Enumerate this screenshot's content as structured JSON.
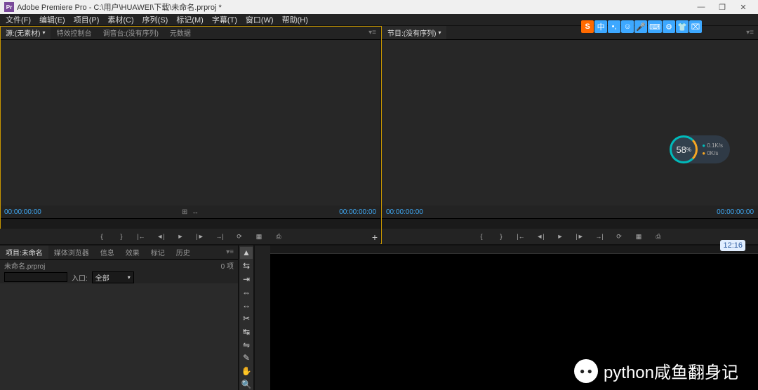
{
  "window": {
    "app_icon_text": "Pr",
    "title": "Adobe Premiere Pro - C:\\用户\\HUAWEI\\下载\\未命名.prproj *",
    "min": "—",
    "max": "❐",
    "close": "✕"
  },
  "menu": {
    "file": "文件(F)",
    "edit": "编辑(E)",
    "project": "项目(P)",
    "clip": "素材(C)",
    "sequence": "序列(S)",
    "marker": "标记(M)",
    "title": "字幕(T)",
    "window": "窗口(W)",
    "help": "帮助(H)"
  },
  "source_panel": {
    "tabs": {
      "source": "源:(无素材)",
      "fx": "特效控制台",
      "mixer": "调音台:(没有序列)",
      "meta": "元数据"
    },
    "tc_left": "00:00:00:00",
    "tc_right": "00:00:00:00"
  },
  "program_panel": {
    "tab": "节目:(没有序列)",
    "tc_left": "00:00:00:00",
    "tc_right": "00:00:00:00"
  },
  "transport": {
    "mark_in": "{",
    "mark_out": "}",
    "go_in": "|←",
    "step_back": "◄|",
    "play": "►",
    "step_fwd": "|►",
    "go_out": "→|",
    "loop": "⟳",
    "safe": "▦",
    "export": "⎙",
    "plus": "+"
  },
  "project_panel": {
    "tabs": {
      "project": "项目:未命名",
      "browser": "媒体浏览器",
      "info": "信息",
      "effects": "效果",
      "history": "标记",
      "extra": "历史"
    },
    "filename": "未命名.prproj",
    "count": "0 项",
    "search_placeholder": "",
    "in_label": "入口:",
    "in_value": "全部"
  },
  "tools": {
    "select": "▲",
    "track": "⇆",
    "ripple": "⇥",
    "rolling": "⇔",
    "rate": "↔",
    "razor": "✂",
    "slip": "↹",
    "slide": "⇋",
    "pen": "✎",
    "hand": "✋",
    "zoom": "🔍"
  },
  "ime": {
    "logo": "S",
    "mode": "中",
    "punct": "•,",
    "emoji": "☺",
    "mic": "🎤",
    "kb": "⌨",
    "set": "⚙",
    "skin": "👕",
    "pad": "⌧"
  },
  "speed": {
    "percent": "58",
    "unit": "%",
    "up": "0.1K/s",
    "down": "0K/s"
  },
  "clock": {
    "time": "12:16"
  },
  "watermark": {
    "icon": "● ●",
    "text": "python咸鱼翻身记"
  }
}
